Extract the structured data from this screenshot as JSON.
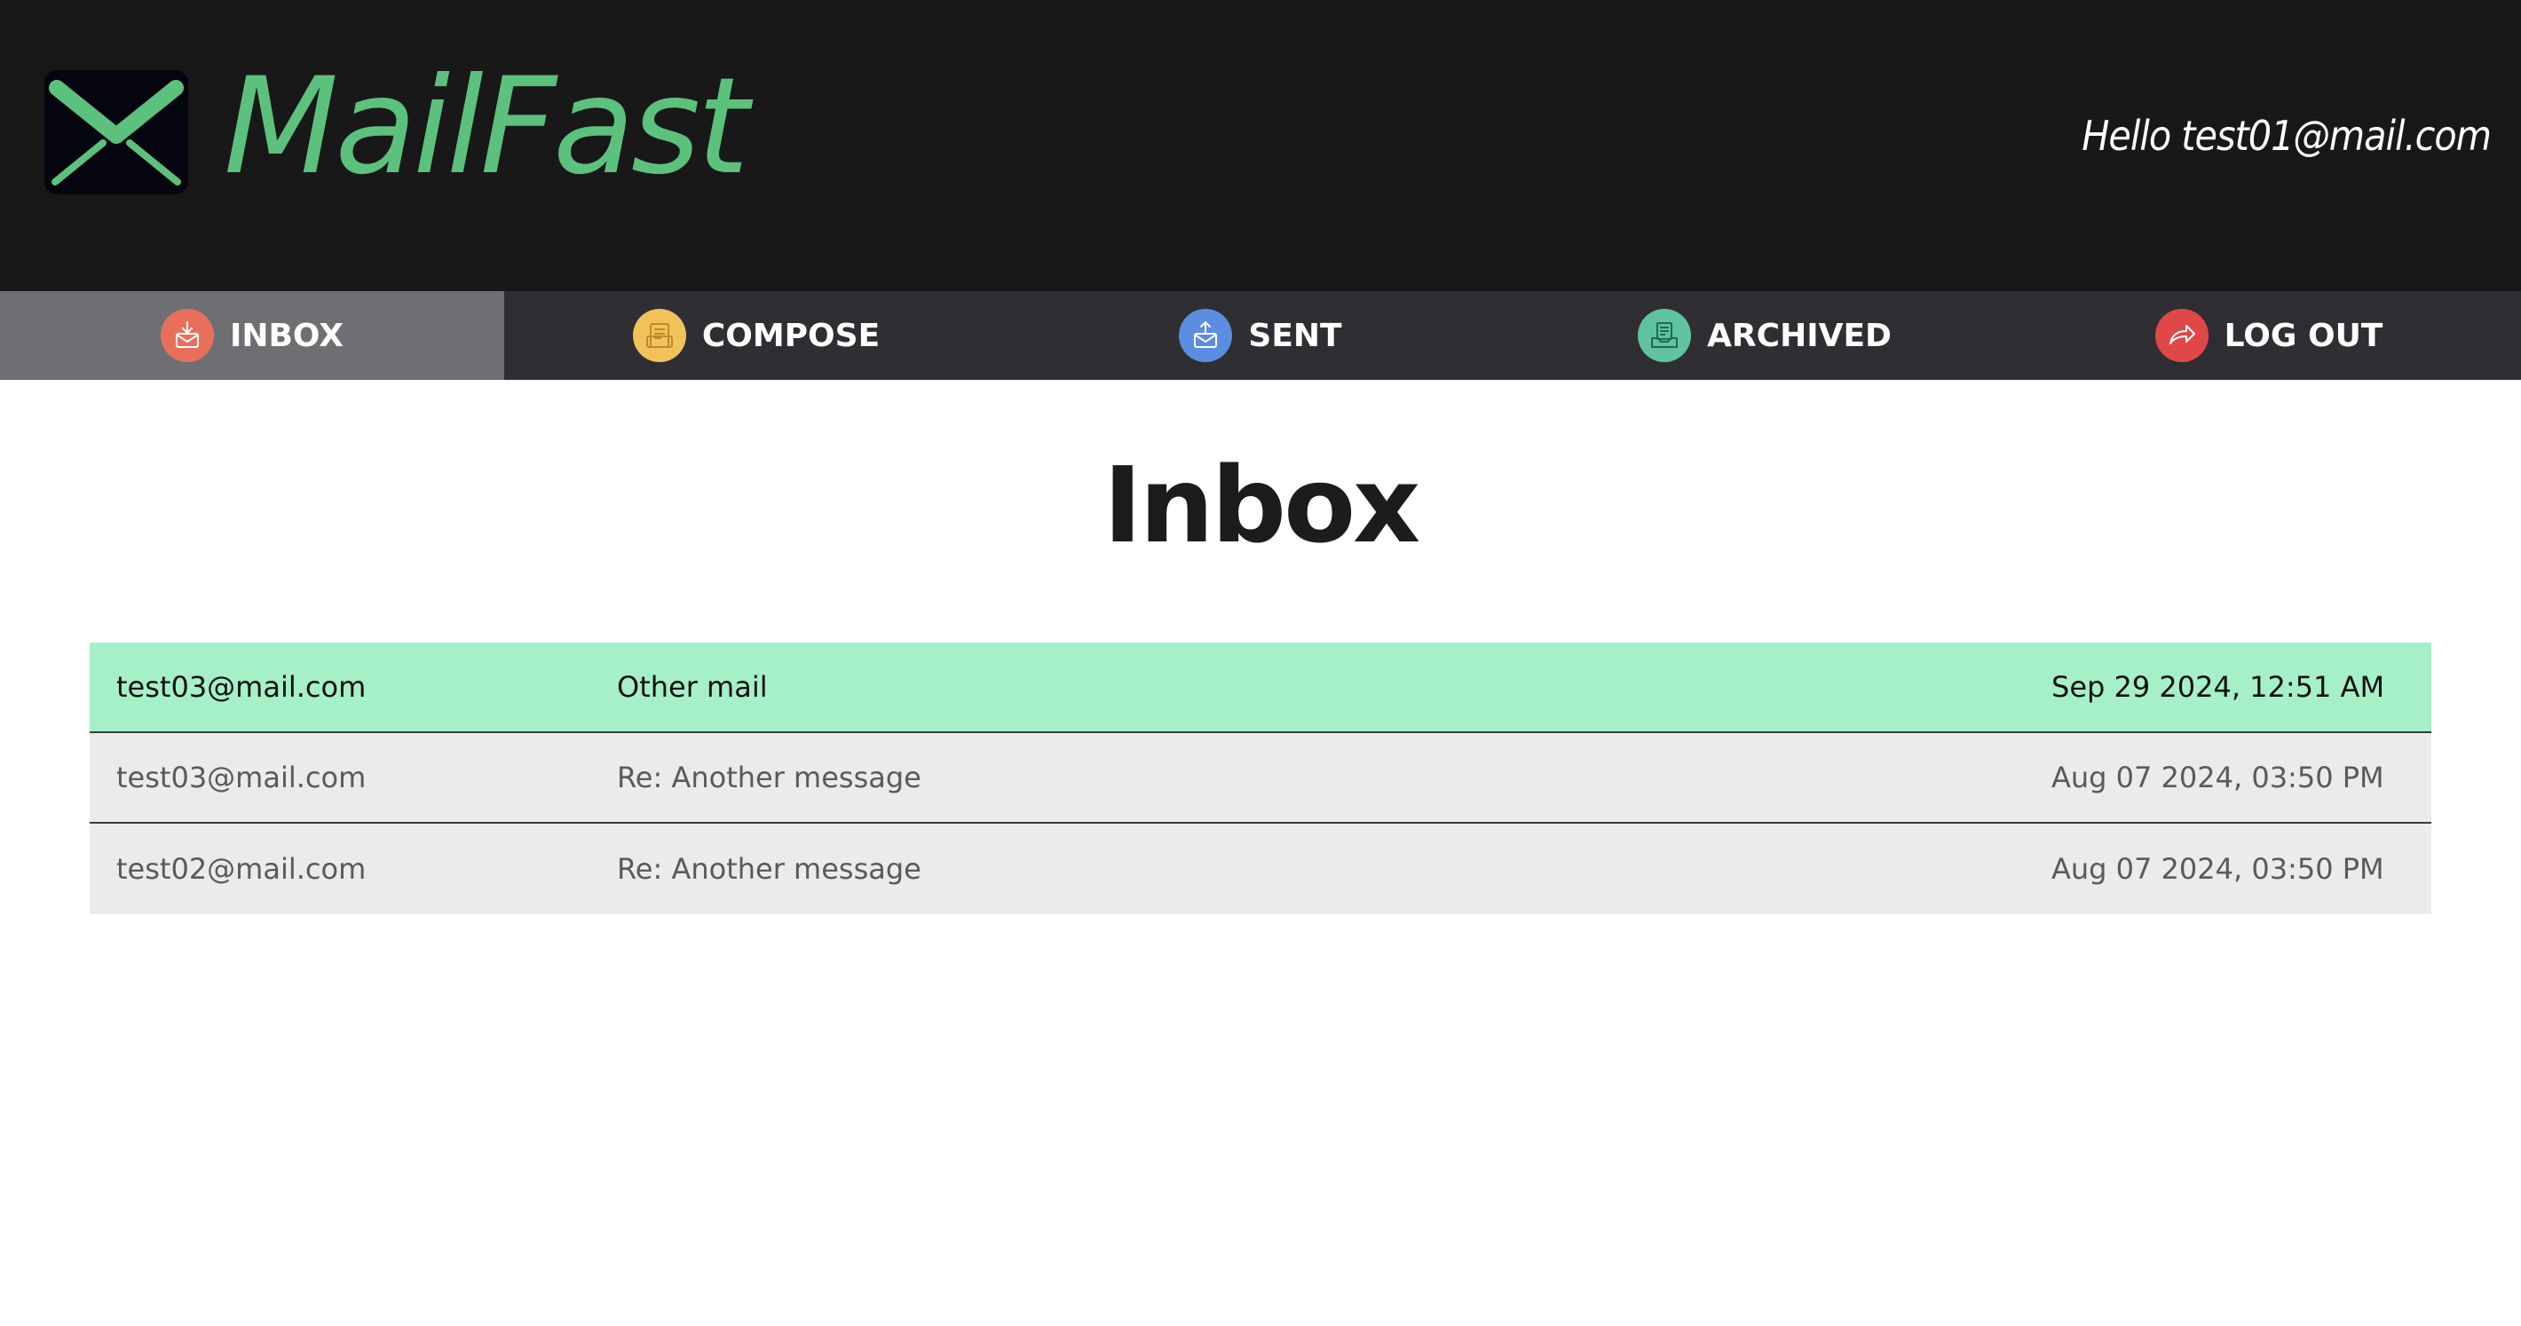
{
  "brand": {
    "name": "MailFast",
    "logo_icon": "envelope-icon",
    "logo_color": "#5cc17c"
  },
  "greeting": "Hello test01@mail.com",
  "nav": {
    "items": [
      {
        "label": "INBOX",
        "icon": "inbox-icon",
        "color": "#e8705a",
        "active": true
      },
      {
        "label": "COMPOSE",
        "icon": "compose-icon",
        "color": "#f0c35a",
        "active": false
      },
      {
        "label": "SENT",
        "icon": "sent-icon",
        "color": "#5b8de0",
        "active": false
      },
      {
        "label": "ARCHIVED",
        "icon": "archive-icon",
        "color": "#5fc2a0",
        "active": false
      },
      {
        "label": "LOG OUT",
        "icon": "logout-icon",
        "color": "#e04848",
        "active": false
      }
    ]
  },
  "page_title": "Inbox",
  "mails": [
    {
      "from": "test03@mail.com",
      "subject": "Other mail",
      "date": "Sep 29 2024, 12:51 AM",
      "unread": true
    },
    {
      "from": "test03@mail.com",
      "subject": "Re: Another message",
      "date": "Aug 07 2024, 03:50 PM",
      "unread": false
    },
    {
      "from": "test02@mail.com",
      "subject": "Re: Another message",
      "date": "Aug 07 2024, 03:50 PM",
      "unread": false
    }
  ],
  "colors": {
    "header_bg": "#181818",
    "nav_bg": "#2f2f33",
    "nav_active_bg": "#6e6f72",
    "unread_row_bg": "#a6f0c8",
    "read_row_bg": "#ebebeb"
  }
}
